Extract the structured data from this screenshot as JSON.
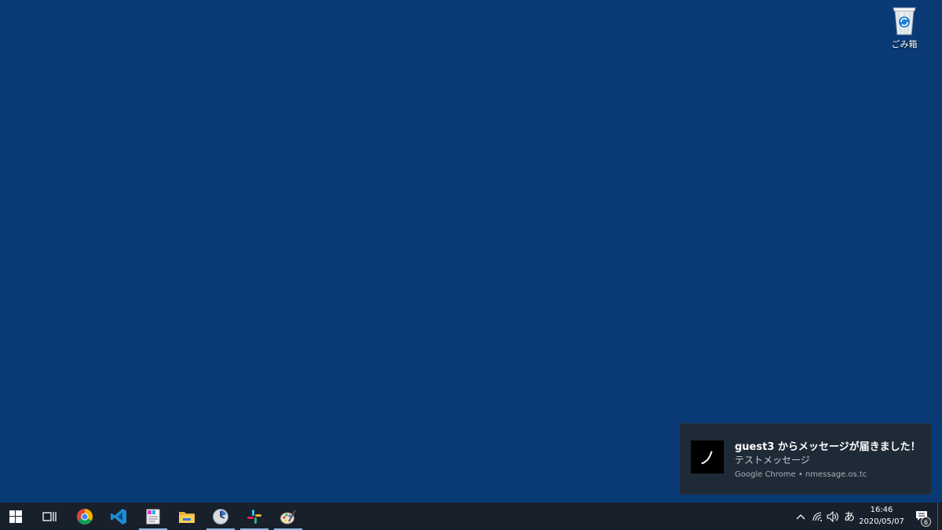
{
  "desktop": {
    "background_color": "#0a3a76",
    "recycle_bin": {
      "label": "ごみ箱",
      "icon": "recycle-bin-icon"
    }
  },
  "notification": {
    "app_icon_glyph": "ノ",
    "title": "guest3 からメッセージが届きました！",
    "body": "テストメッセージ",
    "attribution": "Google Chrome • nmessage.os.tc"
  },
  "taskbar": {
    "background_color": "#17202b",
    "items": [
      {
        "name": "start",
        "icon": "windows-logo-icon",
        "active": false
      },
      {
        "name": "task-view",
        "icon": "task-view-icon",
        "active": false
      },
      {
        "name": "chrome",
        "icon": "chrome-icon",
        "active": false
      },
      {
        "name": "vscode",
        "icon": "vscode-icon",
        "active": false
      },
      {
        "name": "notepad-app",
        "icon": "notepad-icon",
        "active": true
      },
      {
        "name": "file-explorer",
        "icon": "folder-icon",
        "active": false
      },
      {
        "name": "clock-app",
        "icon": "clock-app-icon",
        "active": true
      },
      {
        "name": "slack",
        "icon": "slack-icon",
        "active": true
      },
      {
        "name": "paint",
        "icon": "paint-icon",
        "active": true
      }
    ],
    "tray": {
      "ime": "あ",
      "time": "16:46",
      "date": "2020/05/07",
      "notification_count": "6"
    }
  }
}
